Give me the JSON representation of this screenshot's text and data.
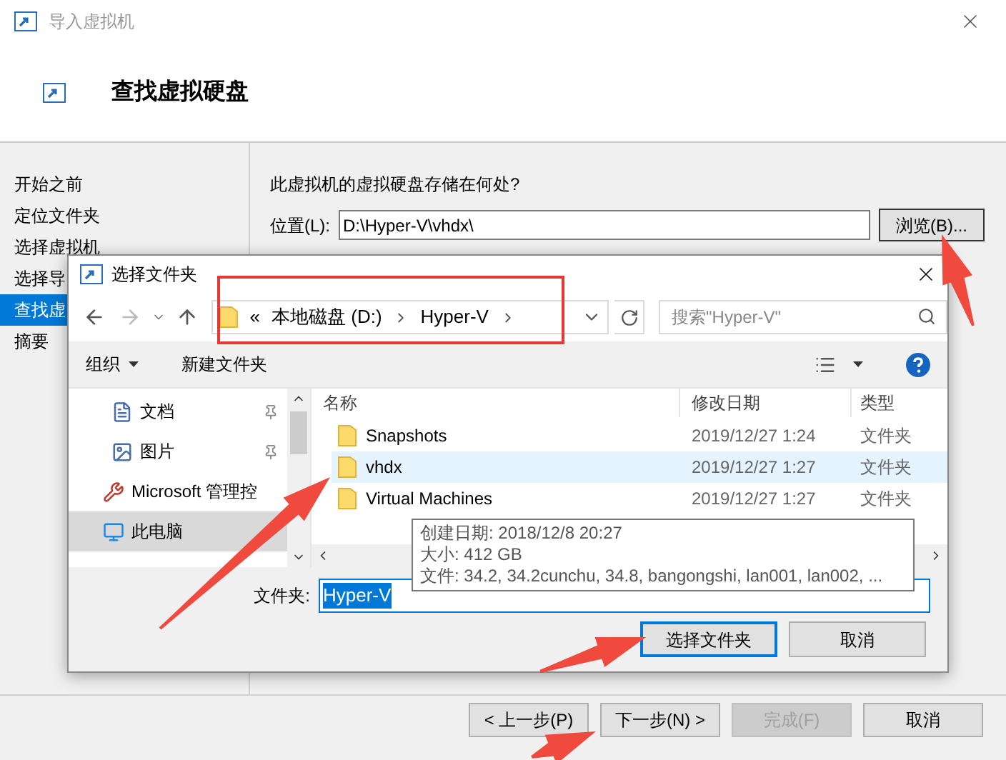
{
  "window": {
    "title": "导入虚拟机"
  },
  "header": {
    "title": "查找虚拟硬盘"
  },
  "steps": [
    {
      "label": "开始之前",
      "selected": false
    },
    {
      "label": "定位文件夹",
      "selected": false
    },
    {
      "label": "选择虚拟机",
      "selected": false
    },
    {
      "label": "选择导",
      "selected": false
    },
    {
      "label": "查找虚",
      "selected": true
    },
    {
      "label": "摘要",
      "selected": false
    }
  ],
  "question": "此虚拟机的虚拟硬盘存储在何处?",
  "location": {
    "label": "位置(L):",
    "value": "D:\\Hyper-V\\vhdx\\",
    "browse": "浏览(B)..."
  },
  "buttons": [
    {
      "label": "< 上一步(P)",
      "disabled": false
    },
    {
      "label": "下一步(N) >",
      "disabled": false
    },
    {
      "label": "完成(F)",
      "disabled": true
    },
    {
      "label": "取消",
      "disabled": false
    }
  ],
  "dialog": {
    "title": "选择文件夹",
    "breadcrumb": [
      "«",
      "本地磁盘 (D:)",
      "Hyper-V"
    ],
    "search": {
      "placeholder": "搜索\"Hyper-V\""
    },
    "toolbar": {
      "organize": "组织",
      "new_folder": "新建文件夹"
    },
    "nav": [
      {
        "label": "文档",
        "kind": "document",
        "pinned": true,
        "selected": false
      },
      {
        "label": "图片",
        "kind": "picture",
        "pinned": true,
        "selected": false
      },
      {
        "label": "Microsoft 管理控",
        "kind": "console",
        "pinned": false,
        "selected": false
      },
      {
        "label": "此电脑",
        "kind": "computer",
        "pinned": false,
        "selected": true
      }
    ],
    "columns": [
      "名称",
      "修改日期",
      "类型"
    ],
    "rows": [
      {
        "name": "Snapshots",
        "date": "2019/12/27 1:24",
        "type": "文件夹",
        "selected": false
      },
      {
        "name": "vhdx",
        "date": "2019/12/27 1:27",
        "type": "文件夹",
        "selected": true
      },
      {
        "name": "Virtual Machines",
        "date": "2019/12/27 1:27",
        "type": "文件夹",
        "selected": false
      }
    ],
    "tooltip": [
      "创建日期: 2018/12/8 20:27",
      "大小: 412 GB",
      "文件: 34.2, 34.2cunchu, 34.8, bangongshi, lan001, lan002, ..."
    ],
    "folder": {
      "label": "文件夹:",
      "value": "Hyper-V"
    },
    "buttons": [
      {
        "label": "选择文件夹",
        "default": true
      },
      {
        "label": "取消",
        "default": false
      }
    ]
  }
}
